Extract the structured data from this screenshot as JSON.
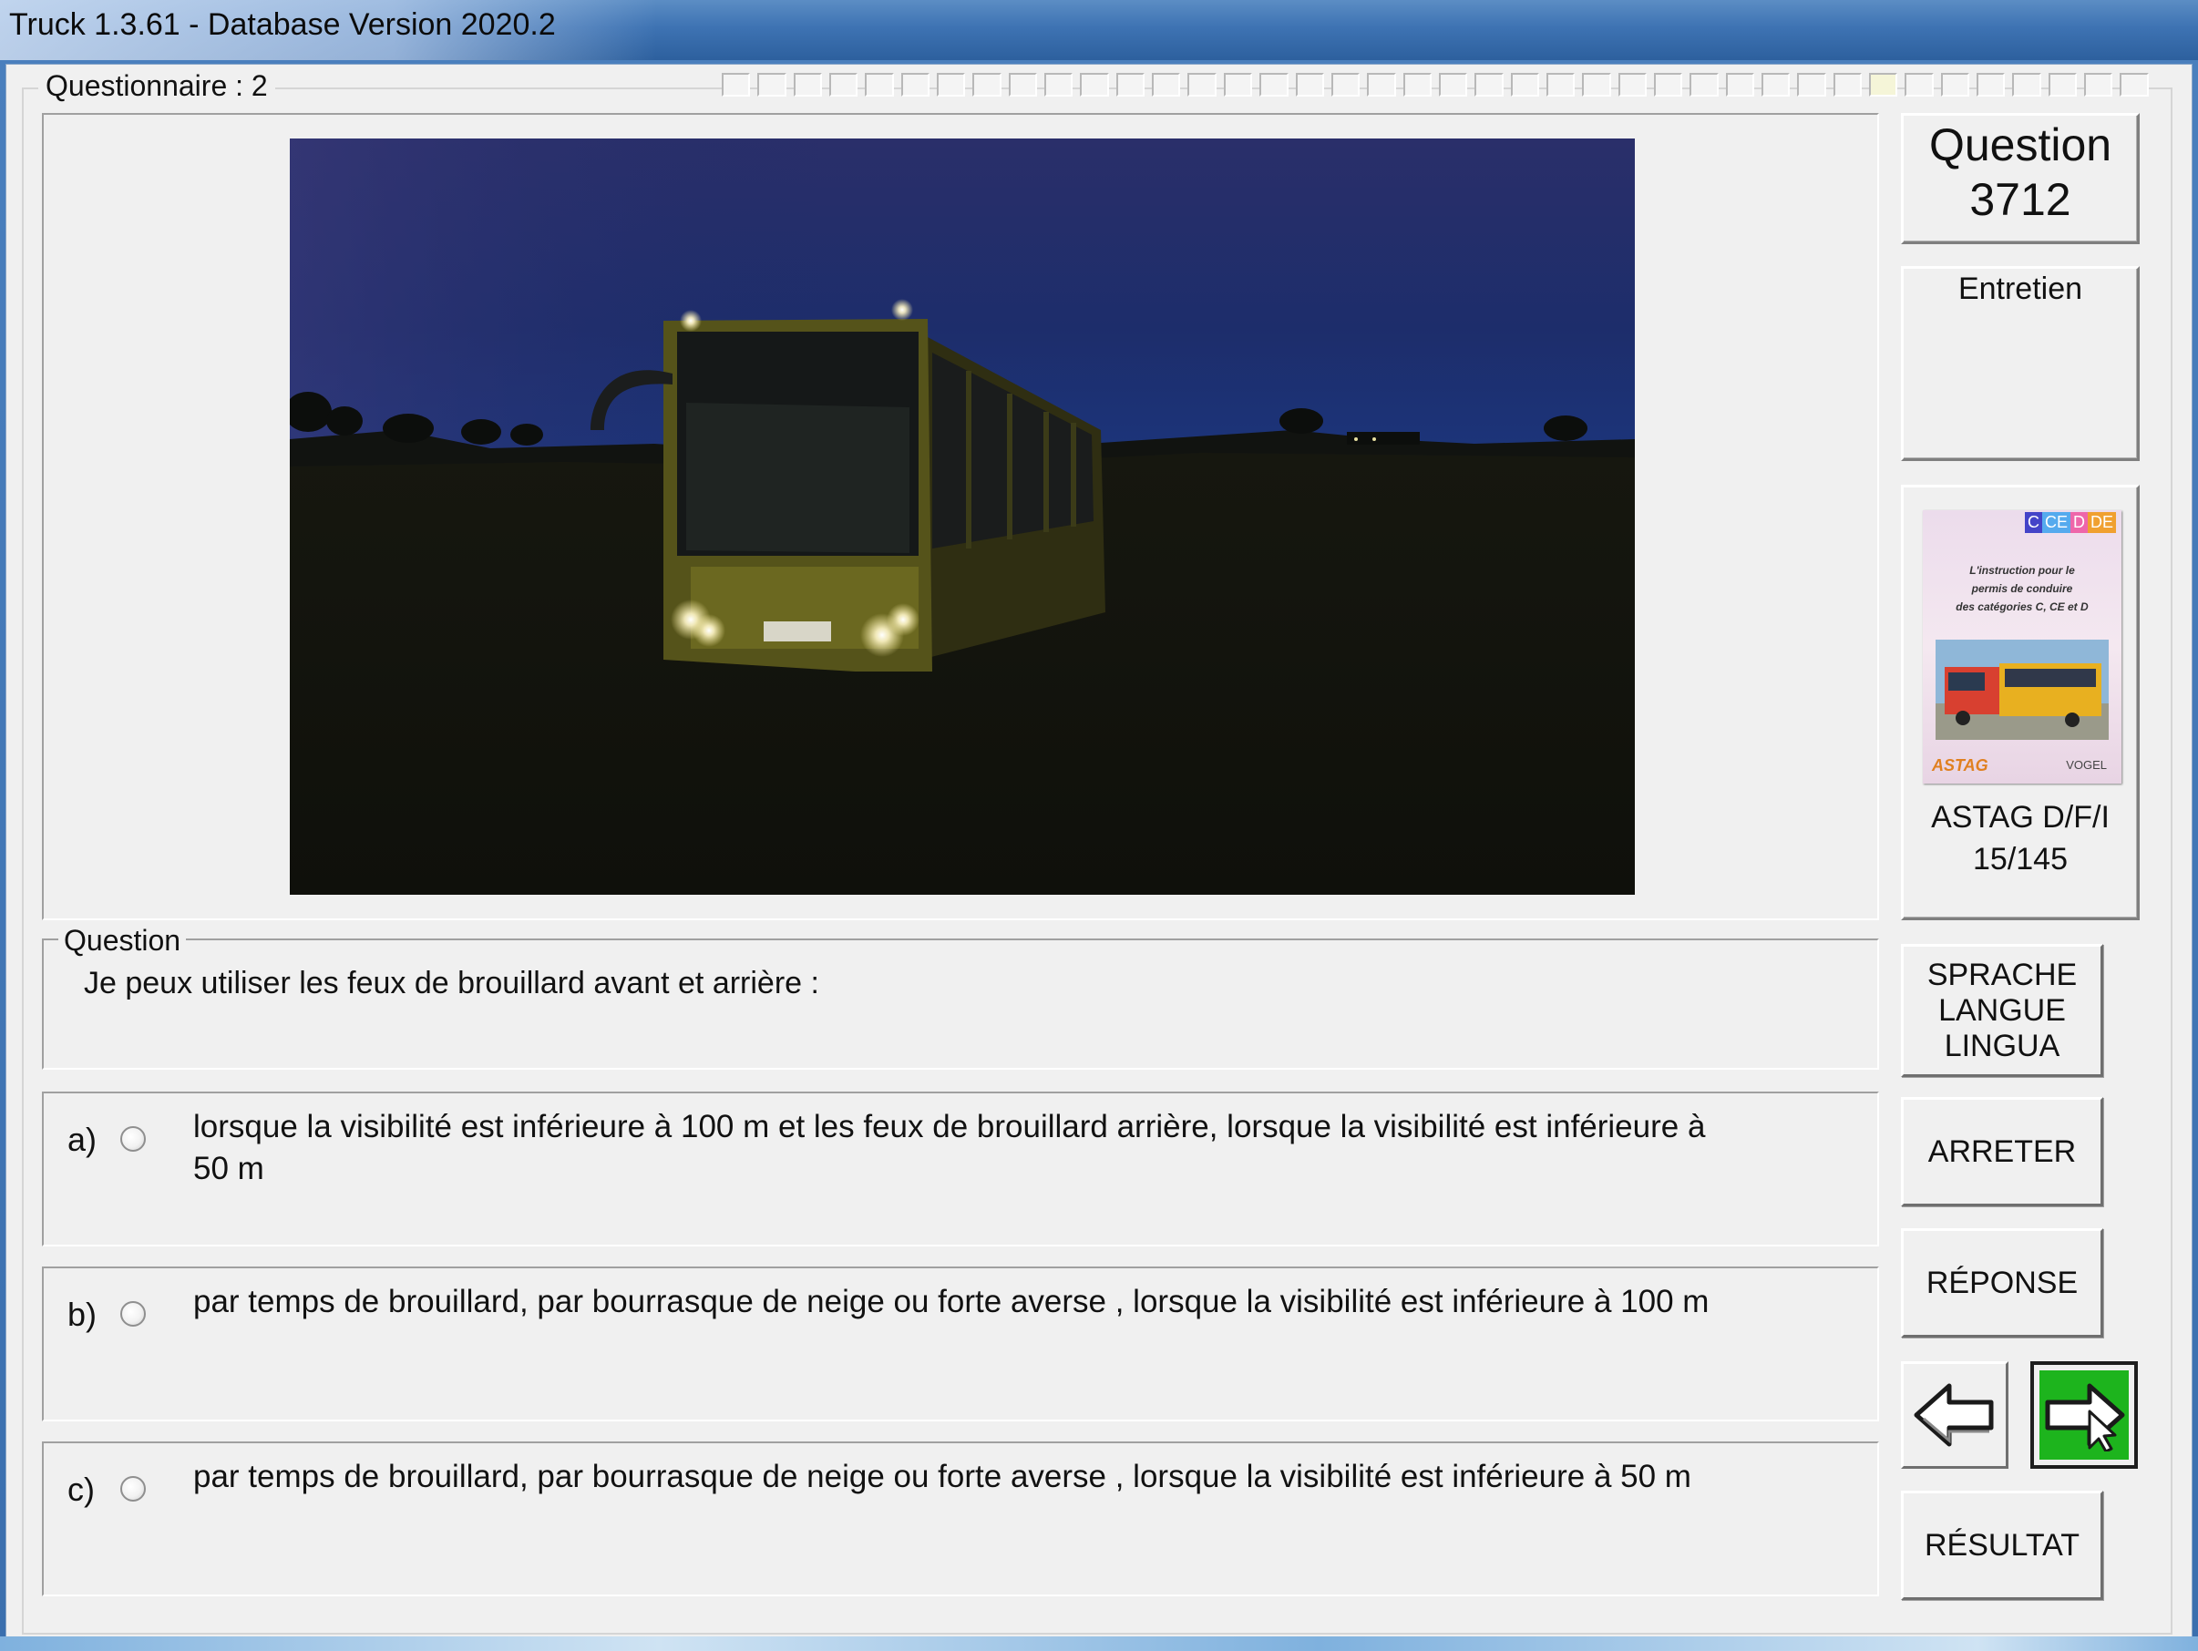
{
  "window": {
    "title": "Truck 1.3.61 - Database Version 2020.2"
  },
  "questionnaire": {
    "label": "Questionnaire : 2",
    "total_segments": 40,
    "done_segments": 1
  },
  "question": {
    "section_label": "Question",
    "text": "Je peux utiliser les feux de brouillard avant et arrière :"
  },
  "answers": [
    {
      "letter": "a)",
      "line1": "lorsque la visibilité est inférieure à 100 m et les feux de brouillard arrière, lorsque la visibilité est inférieure à",
      "line2": "50 m",
      "selected": false
    },
    {
      "letter": "b)",
      "line1": "par temps de brouillard, par bourrasque de neige ou forte averse , lorsque la visibilité est inférieure à 100 m",
      "line2": "",
      "selected": false
    },
    {
      "letter": "c)",
      "line1": "par temps de brouillard, par bourrasque de neige ou forte averse , lorsque la visibilité est inférieure à 50 m",
      "line2": "",
      "selected": false
    }
  ],
  "sidebar": {
    "question_title": "Question",
    "question_number": "3712",
    "category": "Entretien",
    "book": {
      "badges": [
        "C",
        "CE",
        "D",
        "DE"
      ],
      "cover_text_1": "L'instruction pour le",
      "cover_text_2": "permis de conduire",
      "cover_text_3": "des catégories C, CE et D",
      "publisher_left": "ASTAG",
      "publisher_right": "VOGEL",
      "caption_1": "ASTAG D/F/I",
      "caption_2": "15/145"
    },
    "buttons": {
      "language_1": "SPRACHE",
      "language_2": "LANGUE",
      "language_3": "LINGUA",
      "stop": "ARRETER",
      "answer": "RÉPONSE",
      "result": "RÉSULTAT"
    },
    "next_color": "#1db41d"
  }
}
